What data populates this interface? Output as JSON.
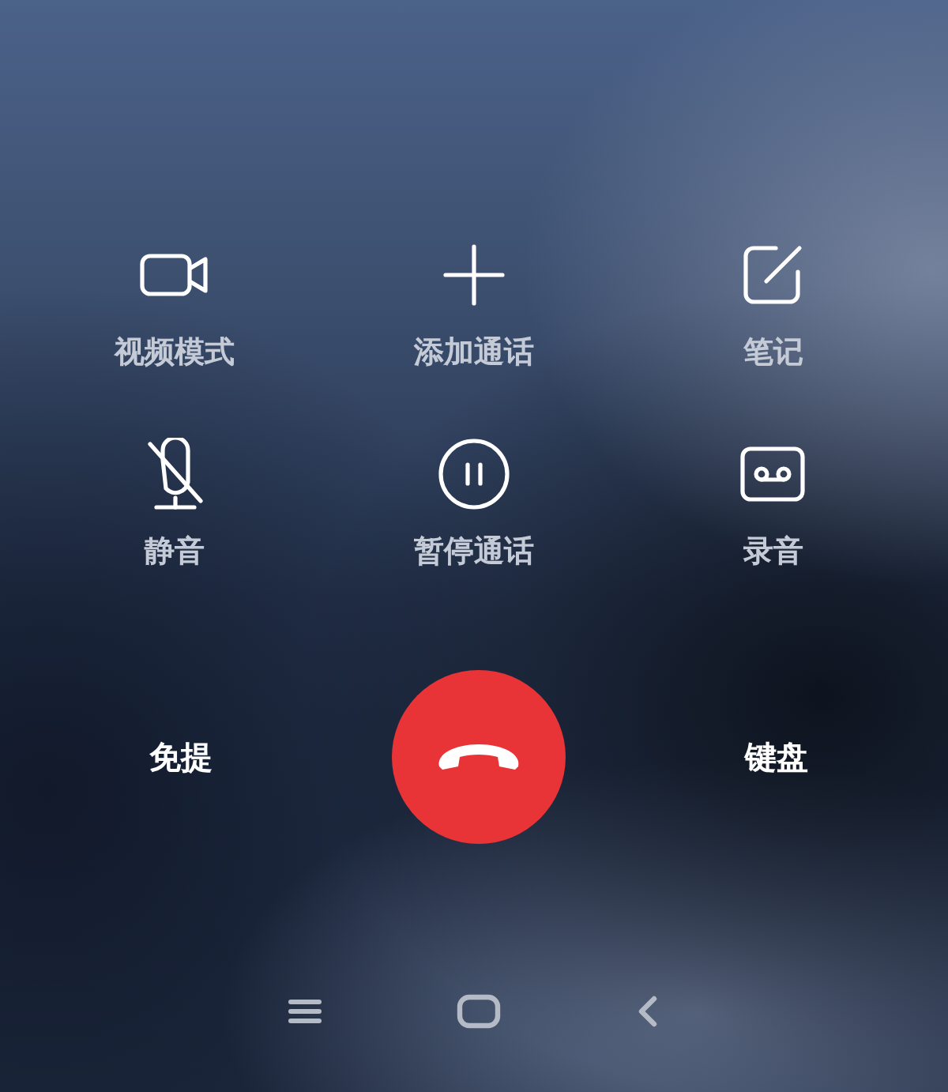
{
  "controls": [
    {
      "kind": "video",
      "label": "视频模式"
    },
    {
      "kind": "add",
      "label": "添加通话"
    },
    {
      "kind": "note",
      "label": "笔记"
    },
    {
      "kind": "mute",
      "label": "静音"
    },
    {
      "kind": "hold",
      "label": "暂停通话"
    },
    {
      "kind": "record",
      "label": "录音"
    }
  ],
  "speaker": "免提",
  "keypad": "键盘"
}
